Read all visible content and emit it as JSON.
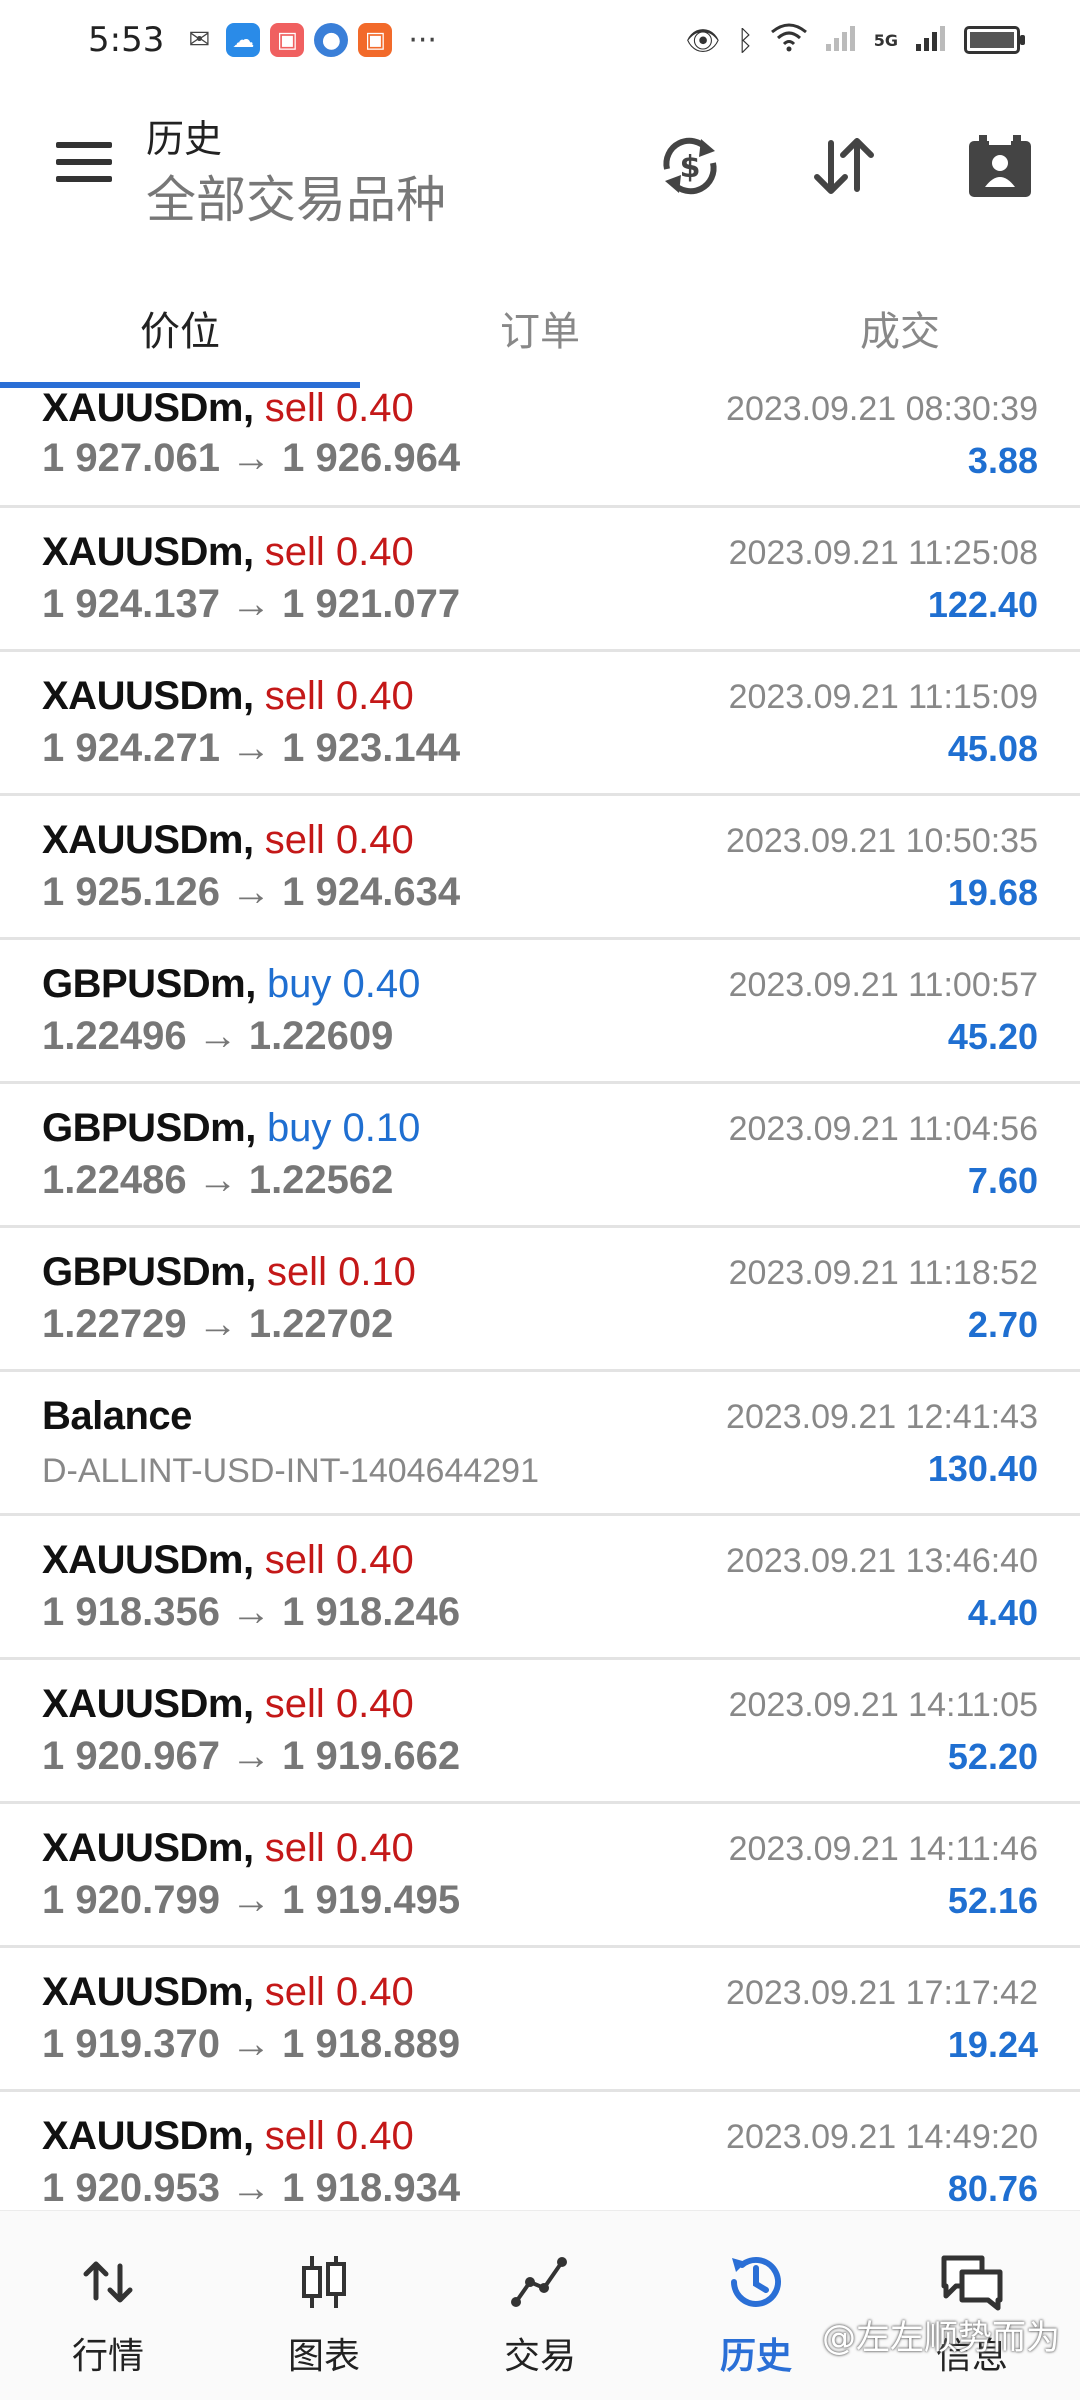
{
  "status_bar": {
    "time": "5:53",
    "network": "5G",
    "more": "···"
  },
  "header": {
    "title": "历史",
    "subtitle": "全部交易品种"
  },
  "tabs": [
    {
      "label": "价位",
      "active": true
    },
    {
      "label": "订单",
      "active": false
    },
    {
      "label": "成交",
      "active": false
    }
  ],
  "colors": {
    "accent": "#2a6fd6",
    "sell": "#c41818",
    "buy": "#1f6fd1",
    "profit": "#1f6fd1"
  },
  "rows": [
    {
      "symbol": "XAUUSDm,",
      "side": "sell 0.40",
      "type": "sell",
      "prices": "1 927.061 → 1 926.964",
      "time": "2023.09.21 08:30:39",
      "profit": "3.88"
    },
    {
      "symbol": "XAUUSDm,",
      "side": "sell 0.40",
      "type": "sell",
      "prices": "1 924.137 → 1 921.077",
      "time": "2023.09.21 11:25:08",
      "profit": "122.40"
    },
    {
      "symbol": "XAUUSDm,",
      "side": "sell 0.40",
      "type": "sell",
      "prices": "1 924.271 → 1 923.144",
      "time": "2023.09.21 11:15:09",
      "profit": "45.08"
    },
    {
      "symbol": "XAUUSDm,",
      "side": "sell 0.40",
      "type": "sell",
      "prices": "1 925.126 → 1 924.634",
      "time": "2023.09.21 10:50:35",
      "profit": "19.68"
    },
    {
      "symbol": "GBPUSDm,",
      "side": "buy 0.40",
      "type": "buy",
      "prices": "1.22496 → 1.22609",
      "time": "2023.09.21 11:00:57",
      "profit": "45.20"
    },
    {
      "symbol": "GBPUSDm,",
      "side": "buy 0.10",
      "type": "buy",
      "prices": "1.22486 → 1.22562",
      "time": "2023.09.21 11:04:56",
      "profit": "7.60"
    },
    {
      "symbol": "GBPUSDm,",
      "side": "sell 0.10",
      "type": "sell",
      "prices": "1.22729 → 1.22702",
      "time": "2023.09.21 11:18:52",
      "profit": "2.70"
    },
    {
      "symbol": "Balance",
      "side": "",
      "type": "balance",
      "prices": "D-ALLINT-USD-INT-1404644291",
      "time": "2023.09.21 12:41:43",
      "profit": "130.40"
    },
    {
      "symbol": "XAUUSDm,",
      "side": "sell 0.40",
      "type": "sell",
      "prices": "1 918.356 → 1 918.246",
      "time": "2023.09.21 13:46:40",
      "profit": "4.40"
    },
    {
      "symbol": "XAUUSDm,",
      "side": "sell 0.40",
      "type": "sell",
      "prices": "1 920.967 → 1 919.662",
      "time": "2023.09.21 14:11:05",
      "profit": "52.20"
    },
    {
      "symbol": "XAUUSDm,",
      "side": "sell 0.40",
      "type": "sell",
      "prices": "1 920.799 → 1 919.495",
      "time": "2023.09.21 14:11:46",
      "profit": "52.16"
    },
    {
      "symbol": "XAUUSDm,",
      "side": "sell 0.40",
      "type": "sell",
      "prices": "1 919.370 → 1 918.889",
      "time": "2023.09.21 17:17:42",
      "profit": "19.24"
    },
    {
      "symbol": "XAUUSDm,",
      "side": "sell 0.40",
      "type": "sell",
      "prices": "1 920.953 → 1 918.934",
      "time": "2023.09.21 14:49:20",
      "profit": "80.76"
    }
  ],
  "bottom_nav": [
    {
      "label": "行情",
      "icon": "quotes-icon",
      "active": false
    },
    {
      "label": "图表",
      "icon": "chart-icon",
      "active": false
    },
    {
      "label": "交易",
      "icon": "trade-icon",
      "active": false
    },
    {
      "label": "历史",
      "icon": "history-icon",
      "active": true
    },
    {
      "label": "信息",
      "icon": "messages-icon",
      "active": false
    }
  ],
  "watermark": "@左左顺势而为"
}
